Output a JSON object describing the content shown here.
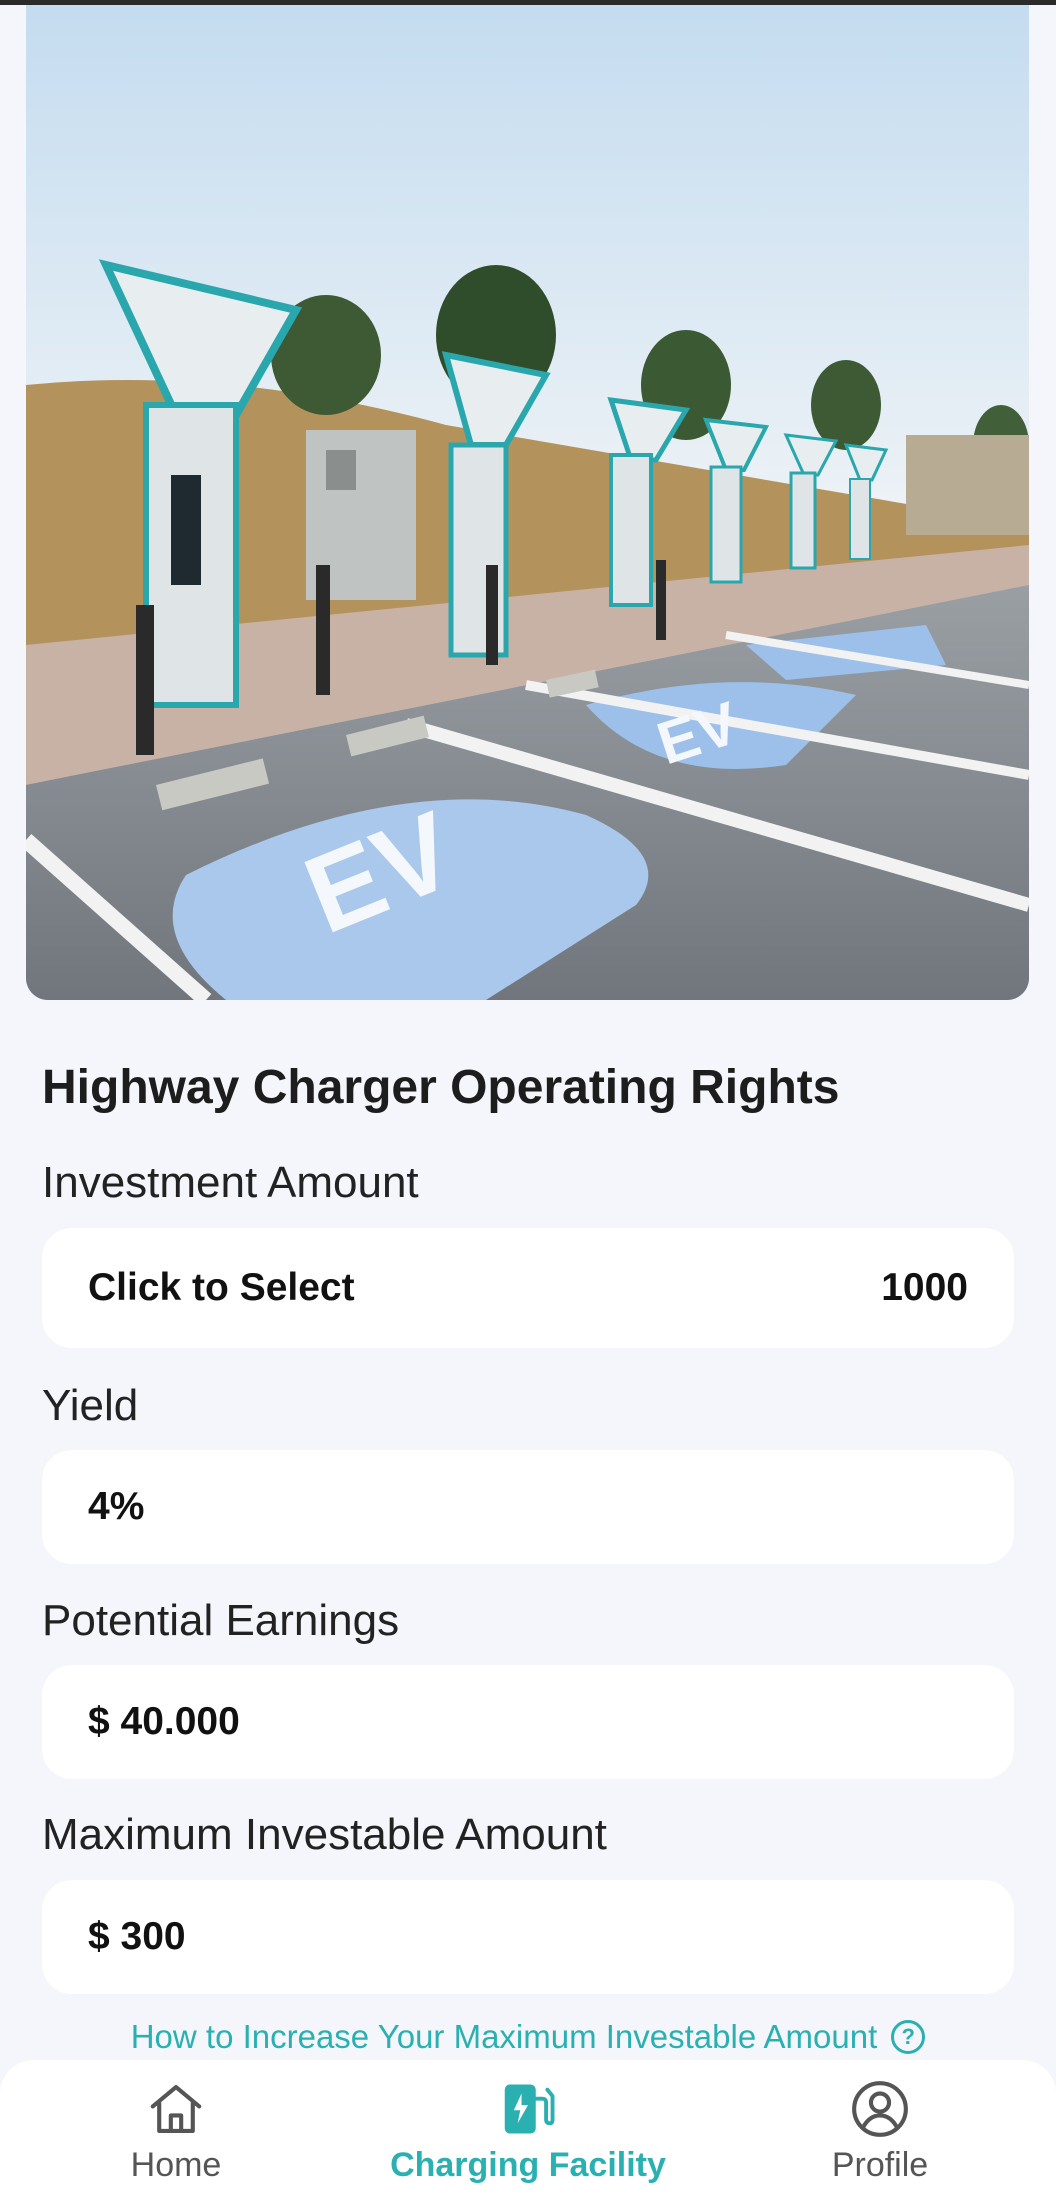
{
  "product": {
    "title": "Highway Charger Operating Rights"
  },
  "investment": {
    "label": "Investment Amount",
    "select_text": "Click to Select",
    "value": "1000"
  },
  "yield": {
    "label": "Yield",
    "value": "4%"
  },
  "earnings": {
    "label": "Potential Earnings",
    "value": "$ 40.000"
  },
  "max_investable": {
    "label": "Maximum Investable Amount",
    "value": "$ 300"
  },
  "help_link": {
    "text": "How to Increase Your Maximum Investable Amount",
    "icon": "question-circle-icon"
  },
  "nav": {
    "items": [
      {
        "label": "Home",
        "icon": "home-icon",
        "active": false
      },
      {
        "label": "Charging Facility",
        "icon": "charging-station-icon",
        "active": true
      },
      {
        "label": "Profile",
        "icon": "user-circle-icon",
        "active": false
      }
    ]
  },
  "colors": {
    "accent": "#2bb0b2",
    "background": "#f4f6fb",
    "field": "#ffffff"
  }
}
